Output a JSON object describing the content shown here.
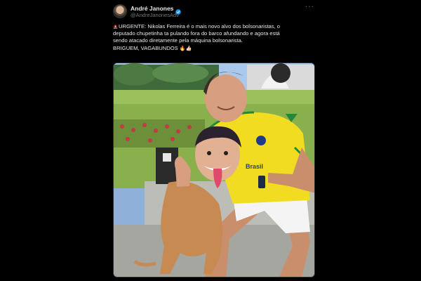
{
  "tweet": {
    "display_name": "André Janones",
    "handle": "@AndreJanonesAdv",
    "more_icon": "more-horizontal-icon",
    "verified_icon": "verified-badge-icon",
    "lines": [
      "URGENTE: Nikolas Ferreira é o mais novo alvo dos bolsonaristas, o",
      "deputado chupetinha ta pulando fora do barco afundando e agora está",
      "sendo atacado diretamente pela máquina bolsonarista.",
      "BRIGUEM, VAGABUNDOS"
    ],
    "line4_emojis": "🔥👍🏻",
    "icons": {
      "siren": "siren-emoji-icon",
      "fire": "fire-emoji-icon",
      "thumbs_up": "thumbs-up-emoji-icon"
    },
    "media": {
      "shirt_text": "Brasil"
    }
  },
  "colors": {
    "background": "#000000",
    "text_primary": "#e7e9ea",
    "text_secondary": "#71767b",
    "verified": "#1d9bf0",
    "shirt_yellow": "#f2dc22",
    "shirt_trim": "#1e8a3a"
  }
}
